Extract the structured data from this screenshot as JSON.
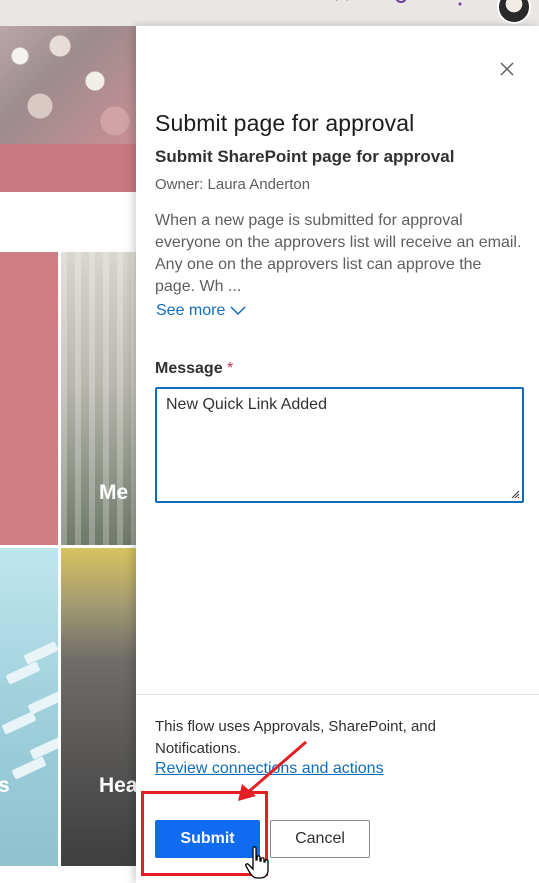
{
  "panel": {
    "title": "Submit page for approval",
    "subtitle": "Submit SharePoint page for approval",
    "owner": "Owner: Laura Anderton",
    "description": "When a new page is submitted for approval everyone on the approvers list will receive an email. Any one on the approvers list can approve the page. Wh ...",
    "see_more": "See more",
    "message_label": "Message",
    "required_marker": "*",
    "message_value": "New Quick Link Added",
    "flow_text": "This flow uses Approvals, SharePoint, and Notifications.",
    "review_link": "Review connections and actions",
    "submit_label": "Submit",
    "cancel_label": "Cancel"
  },
  "background": {
    "tile_labels": [
      "Me",
      "s",
      "Hea"
    ]
  },
  "colors": {
    "accent": "#0f6cbd",
    "primary_button": "#0f6cf0",
    "annotation": "#e31e24",
    "required": "#c4314b"
  },
  "icons": {
    "close": "close-icon",
    "see_more": "chevron-down-icon",
    "cursor": "hand-pointer-icon"
  }
}
